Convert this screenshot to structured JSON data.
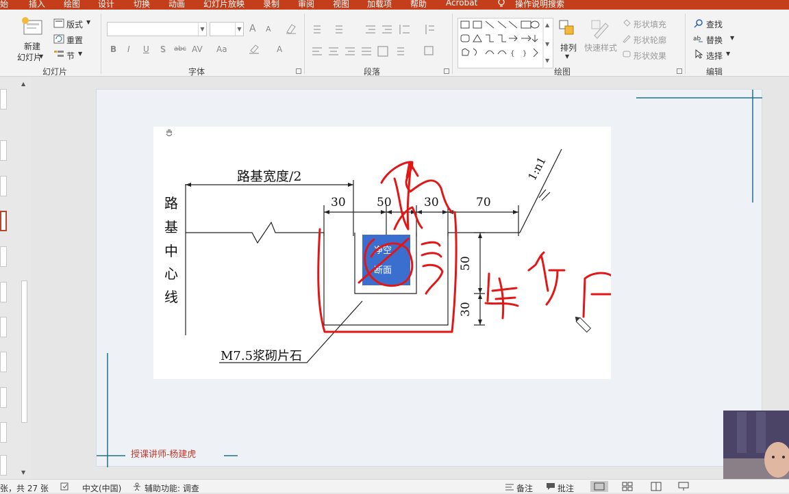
{
  "tabs": [
    {
      "label": "始"
    },
    {
      "label": "插入"
    },
    {
      "label": "绘图"
    },
    {
      "label": "设计"
    },
    {
      "label": "切换"
    },
    {
      "label": "动画"
    },
    {
      "label": "幻灯片放映"
    },
    {
      "label": "录制"
    },
    {
      "label": "审阅"
    },
    {
      "label": "视图"
    },
    {
      "label": "加载项"
    },
    {
      "label": "帮助"
    },
    {
      "label": "Acrobat"
    },
    {
      "label": "操作说明搜索"
    }
  ],
  "ribbon": {
    "slides_group": {
      "new_slide": "新建",
      "new_slide_line2": "幻灯片",
      "layout": "版式",
      "reset": "重置",
      "section": "节",
      "label": "幻灯片"
    },
    "font_group": {
      "font_name": "",
      "font_size": "",
      "bold": "B",
      "italic": "I",
      "underline": "U",
      "shadow": "S",
      "strike": "abc",
      "spacing": "AV",
      "case": "Aa",
      "color": "A",
      "grow": "A",
      "shrink": "A",
      "label": "字体"
    },
    "paragraph_group": {
      "label": "段落"
    },
    "drawing_group": {
      "arrange": "排列",
      "quick_styles": "快速样式",
      "shape_fill": "形状填充",
      "shape_outline": "形状轮廓",
      "shape_effects": "形状效果",
      "label": "绘图"
    },
    "editing_group": {
      "find": "查找",
      "replace": "替换",
      "select": "选择",
      "label": "编辑"
    }
  },
  "slide": {
    "drawing": {
      "width_label": "路基宽度/2",
      "centerline": [
        "路",
        "基",
        "中",
        "心",
        "线"
      ],
      "dim_top": [
        "30",
        "50",
        "30",
        "70"
      ],
      "dim_side": [
        "50",
        "30"
      ],
      "slope": "1:n1",
      "channel_label": [
        "净空",
        "断面"
      ],
      "material": "M7.5浆砌片石"
    },
    "teacher": "授课讲师-杨建虎"
  },
  "status": {
    "slide_count": "张，共 27 张",
    "language": "中文(中国)",
    "accessibility": "辅助功能: 调查",
    "notes": "备注",
    "comments": "批注"
  },
  "colors": {
    "accent": "#c43e1c",
    "ink": "#e31616",
    "highlight_box": "#3b6fcf",
    "slide_lines": "#1f6f8b"
  }
}
